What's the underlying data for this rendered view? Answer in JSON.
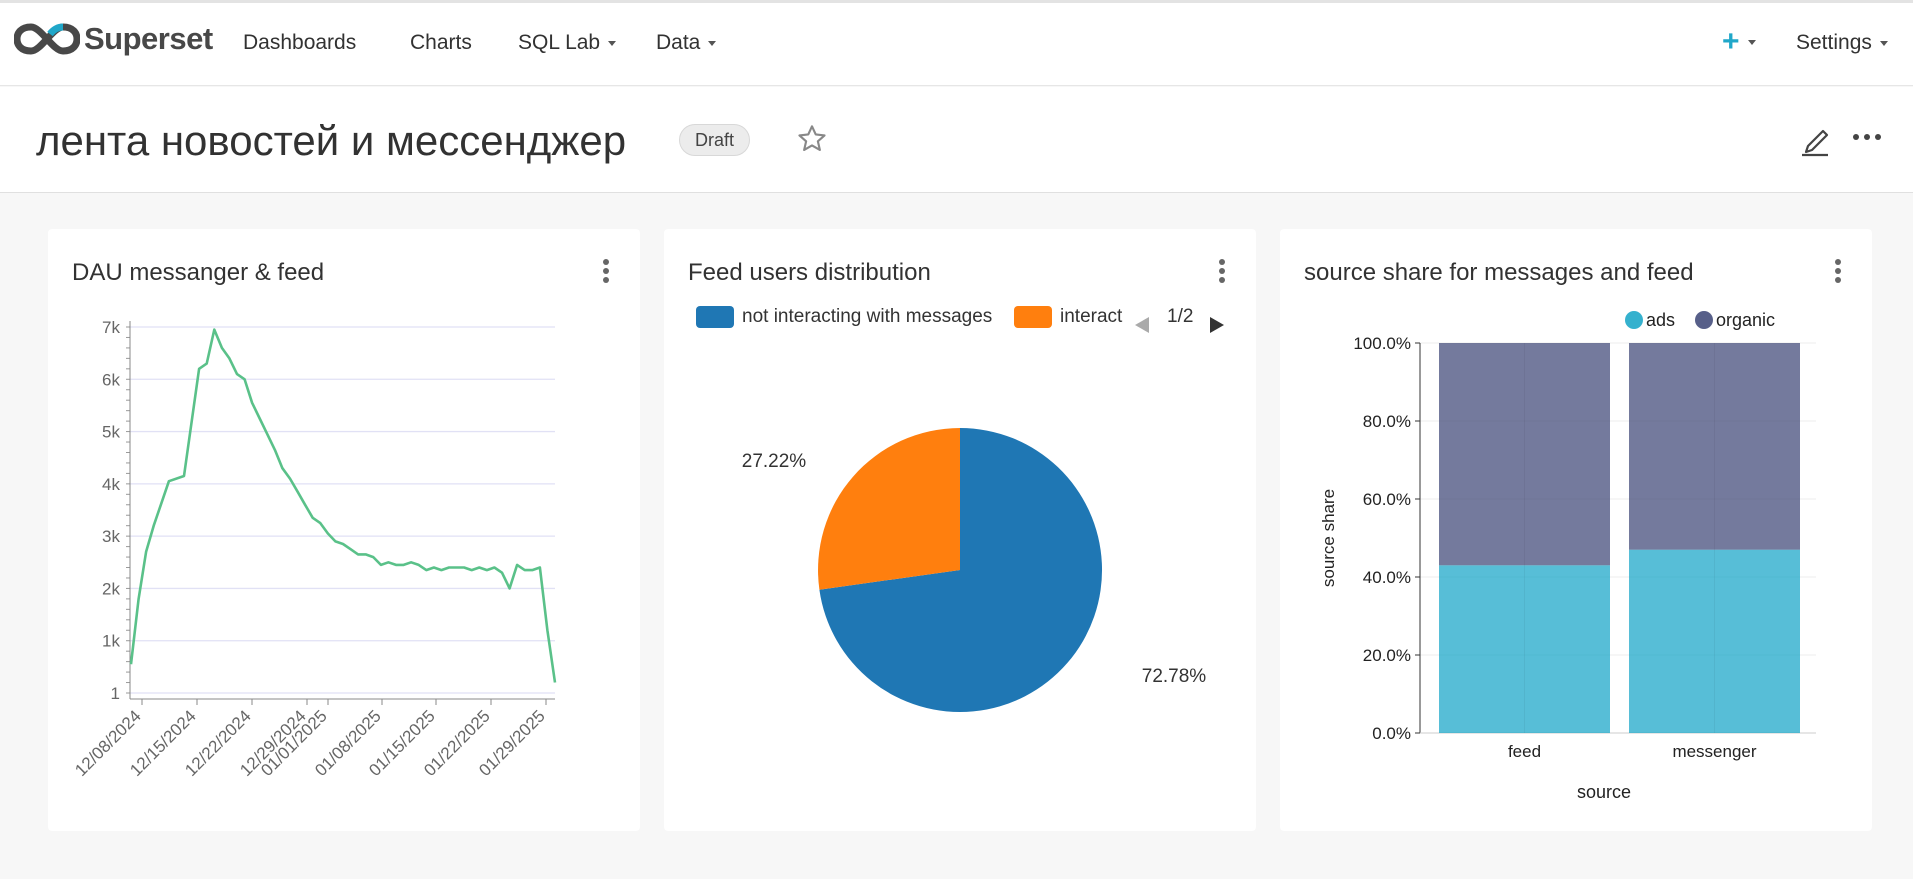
{
  "nav": {
    "brand": "Superset",
    "items": [
      {
        "label": "Dashboards"
      },
      {
        "label": "Charts"
      },
      {
        "label": "SQL Lab"
      },
      {
        "label": "Data"
      }
    ],
    "plus": "+",
    "settings": "Settings"
  },
  "dashboard": {
    "title": "лента новостей и мессенджер",
    "status": "Draft"
  },
  "charts": [
    {
      "title": "DAU messanger & feed"
    },
    {
      "title": "Feed users distribution"
    },
    {
      "title": "source share for messages and feed"
    }
  ],
  "chart_data": [
    {
      "type": "line",
      "title": "DAU messanger & feed",
      "y_ticks": [
        "1",
        "1k",
        "2k",
        "3k",
        "4k",
        "5k",
        "6k",
        "7k"
      ],
      "ylim": [
        0,
        7000
      ],
      "x_ticks": [
        "12/08/2024",
        "12/15/2024",
        "12/22/2024",
        "12/29/2024",
        "01/01/2025",
        "01/08/2025",
        "01/15/2025",
        "01/22/2025",
        "01/29/2025"
      ],
      "color": "#5ac189",
      "x": [
        "2024-12-08",
        "2024-12-09",
        "2024-12-10",
        "2024-12-11",
        "2024-12-13",
        "2024-12-15",
        "2024-12-17",
        "2024-12-18",
        "2024-12-19",
        "2024-12-20",
        "2024-12-21",
        "2024-12-22",
        "2024-12-23",
        "2024-12-24",
        "2024-12-25",
        "2024-12-26",
        "2024-12-27",
        "2024-12-28",
        "2024-12-29",
        "2024-12-30",
        "2024-12-31",
        "2025-01-01",
        "2025-01-02",
        "2025-01-03",
        "2025-01-04",
        "2025-01-05",
        "2025-01-06",
        "2025-01-07",
        "2025-01-08",
        "2025-01-09",
        "2025-01-10",
        "2025-01-11",
        "2025-01-12",
        "2025-01-13",
        "2025-01-14",
        "2025-01-15",
        "2025-01-16",
        "2025-01-17",
        "2025-01-18",
        "2025-01-19",
        "2025-01-20",
        "2025-01-21",
        "2025-01-22",
        "2025-01-23",
        "2025-01-24",
        "2025-01-25",
        "2025-01-26",
        "2025-01-27",
        "2025-01-28",
        "2025-01-29",
        "2025-01-30",
        "2025-01-31",
        "2025-02-01",
        "2025-02-02"
      ],
      "y": [
        550,
        1800,
        2700,
        3200,
        4050,
        4150,
        6200,
        6300,
        6950,
        6600,
        6400,
        6100,
        6000,
        5550,
        5250,
        4950,
        4650,
        4300,
        4100,
        3850,
        3600,
        3350,
        3250,
        3050,
        2900,
        2850,
        2750,
        2650,
        2650,
        2600,
        2450,
        2500,
        2450,
        2450,
        2500,
        2450,
        2350,
        2400,
        2350,
        2400,
        2400,
        2400,
        2350,
        2400,
        2350,
        2400,
        2300,
        2000,
        2450,
        2350,
        2350,
        2400,
        1200,
        200
      ]
    },
    {
      "type": "pie",
      "title": "Feed users distribution",
      "legend": [
        "not interacting with messages",
        "interact"
      ],
      "legend_page": "1/2",
      "series": [
        {
          "name": "not interacting with messages",
          "value": 72.78,
          "label": "72.78%",
          "color": "#1f77b4"
        },
        {
          "name": "interact",
          "value": 27.22,
          "label": "27.22%",
          "color": "#ff7f0e"
        }
      ]
    },
    {
      "type": "bar",
      "title": "source share for messages and feed",
      "stacked": true,
      "categories": [
        "feed",
        "messenger"
      ],
      "xlabel": "source",
      "ylabel": "source share",
      "ylim": [
        0,
        100
      ],
      "y_ticks": [
        "0.0%",
        "20.0%",
        "40.0%",
        "60.0%",
        "80.0%",
        "100.0%"
      ],
      "legend": "top-right",
      "series": [
        {
          "name": "ads",
          "values": [
            43,
            47
          ],
          "color": "#1FA8C9"
        },
        {
          "name": "organic",
          "values": [
            57,
            53
          ],
          "color": "#454E7C"
        }
      ]
    }
  ]
}
